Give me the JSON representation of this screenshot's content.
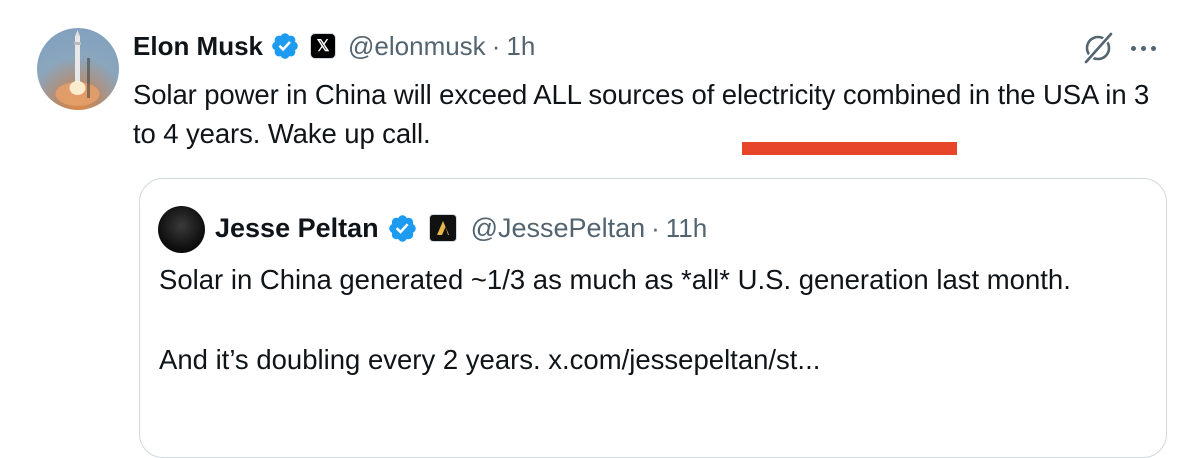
{
  "tweet": {
    "author_name": "Elon Musk",
    "handle": "@elonmusk",
    "separator": "·",
    "time": "1h",
    "text": "Solar power in China will exceed ALL sources of electricity combined in the USA in 3 to 4 years. Wake up call.",
    "verified_icon": "verified-badge-icon",
    "affiliate_icon": "x-logo-icon",
    "affiliate_glyph": "𝕏",
    "grok_icon": "grok-icon",
    "more_icon": "more-icon",
    "underline_color": "#e8462b"
  },
  "quoted": {
    "author_name": "Jesse Peltan",
    "handle": "@JessePeltan",
    "separator": "·",
    "time": "11h",
    "line1": "Solar in China generated ~1/3 as much as *all* U.S. generation last month.",
    "line2": "And it’s doubling every 2 years.  x.com/jessepeltan/st...",
    "verified_icon": "verified-badge-icon",
    "affiliate_icon": "affiliate-logo-icon"
  },
  "colors": {
    "accent": "#1d9bf0",
    "secondary_text": "#536471",
    "primary_text": "#0f1419",
    "border": "#cfd9de"
  }
}
